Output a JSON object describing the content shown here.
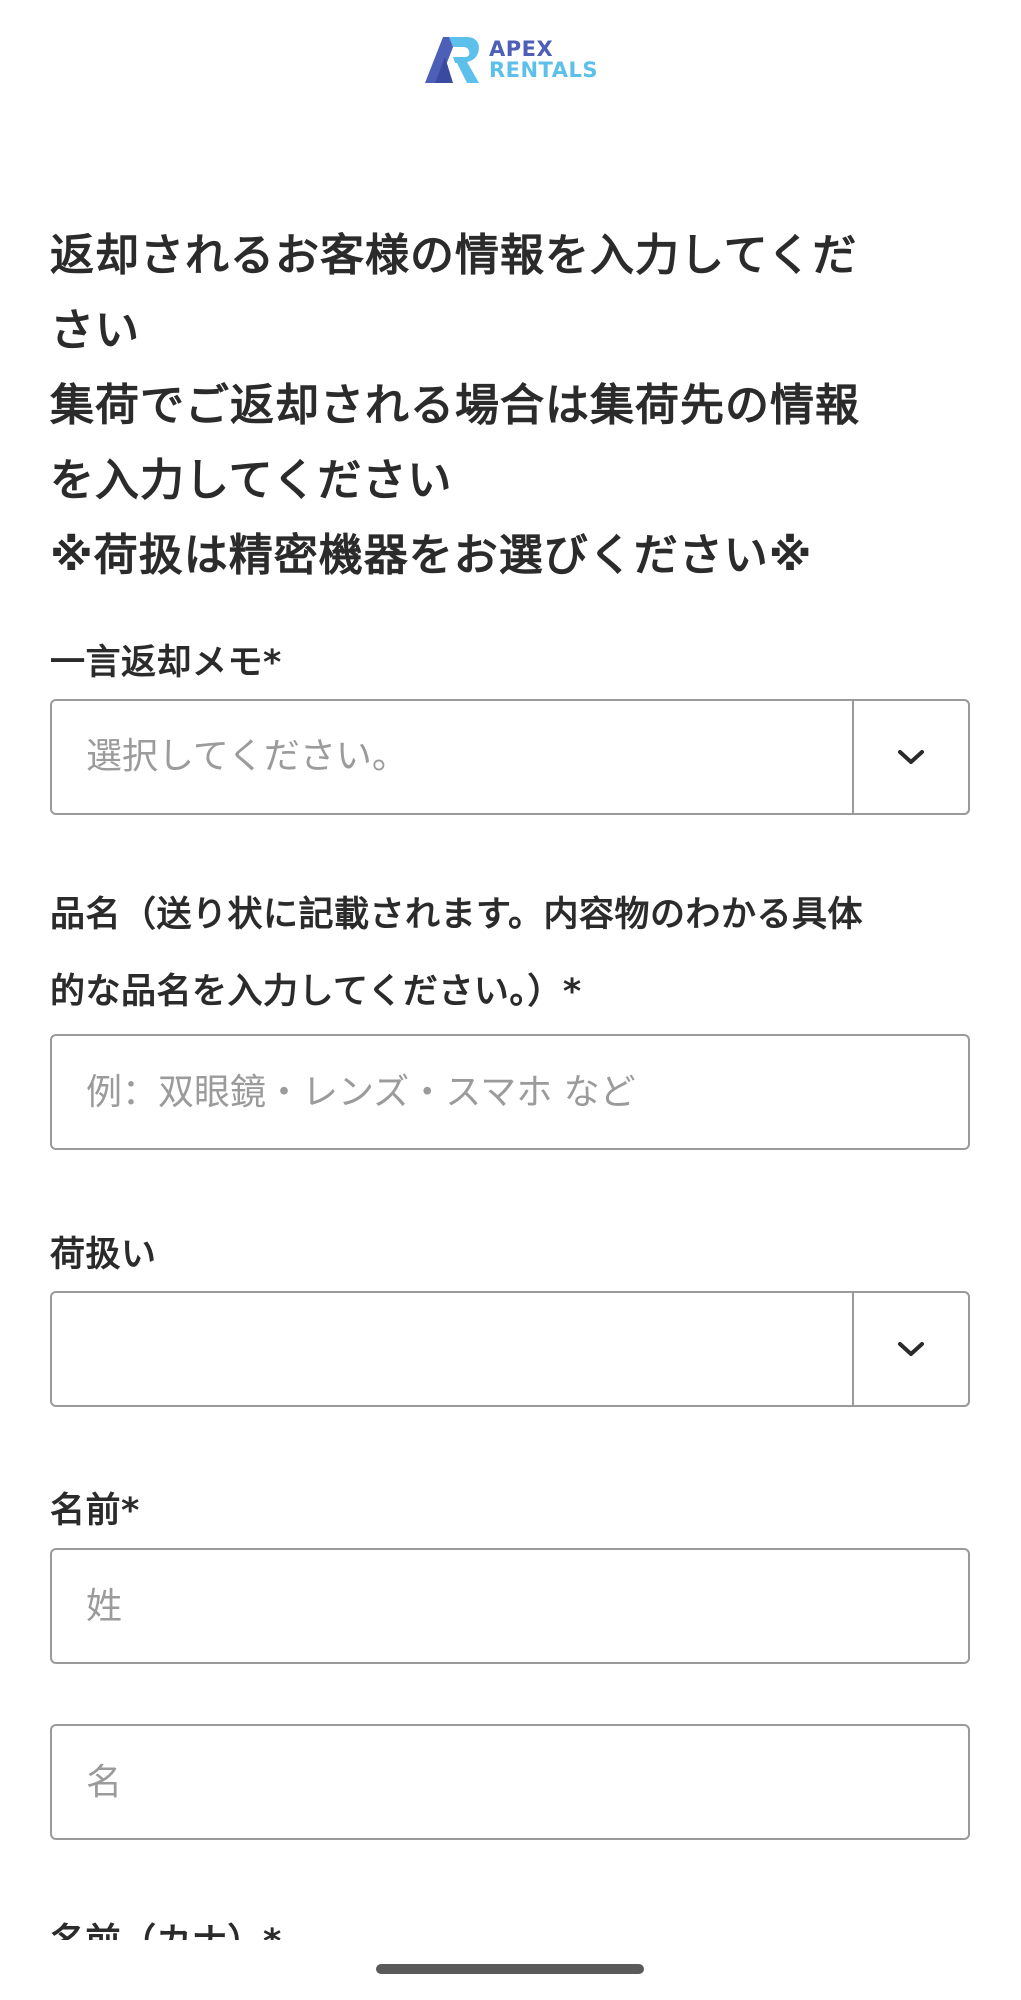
{
  "brand": {
    "line1": "APEX",
    "line2": "RENTALS",
    "colors": {
      "primary": "#4d5fb6",
      "secondary": "#5cc0ea"
    }
  },
  "intro": {
    "lines": [
      "返却されるお客様の情報を入力してくだ",
      "さい",
      "集荷でご返却される場合は集荷先の情報",
      "を入力してください",
      "※荷扱は精密機器をお選びください※"
    ]
  },
  "fields": {
    "memo": {
      "label": "一言返却メモ*",
      "placeholder": "選択してください。",
      "icon": "chevron-down-icon"
    },
    "item_name": {
      "label_line1": "品名（送り状に記載されます。内容物のわかる具体",
      "label_line2": "的な品名を入力してください。）*",
      "placeholder": "例：双眼鏡・レンズ・スマホ など",
      "value": ""
    },
    "handling": {
      "label": "荷扱い",
      "value": "",
      "icon": "chevron-down-icon"
    },
    "name": {
      "label": "名前*",
      "last_placeholder": "姓",
      "first_placeholder": "名"
    },
    "name_kana": {
      "label": "名前（カナ）*"
    }
  }
}
